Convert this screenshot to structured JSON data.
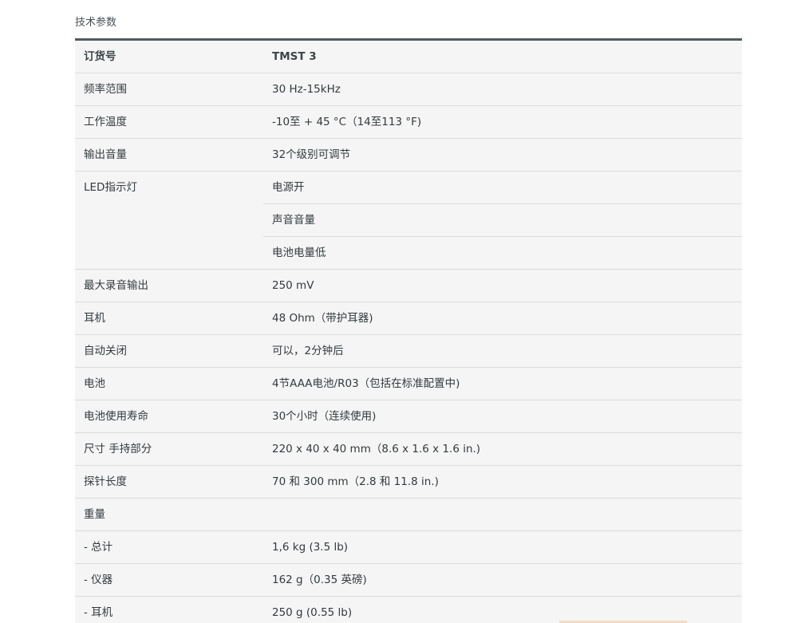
{
  "section_title": "技术参数",
  "table": {
    "header": {
      "label": "订货号",
      "value": "TMST 3"
    },
    "rows": [
      {
        "label": "频率范围",
        "value": "30 Hz-15kHz"
      },
      {
        "label": "工作温度",
        "value": "-10至 + 45 °C（14至113 °F)"
      },
      {
        "label": "输出音量",
        "value": "32个级别可调节"
      }
    ],
    "led": {
      "label": "LED指示灯",
      "values": [
        "电源开",
        "声音音量",
        "电池电量低"
      ]
    },
    "rows2": [
      {
        "label": "最大录音输出",
        "value": "250 mV"
      },
      {
        "label": "耳机",
        "value": "48 Ohm（带护耳器)"
      },
      {
        "label": "自动关闭",
        "value": "可以，2分钟后"
      },
      {
        "label": "电池",
        "value": "4节AAA电池/R03（包括在标准配置中)"
      },
      {
        "label": "电池使用寿命",
        "value": "30个小时（连续使用)"
      },
      {
        "label": "尺寸 手持部分",
        "value": "220 x 40 x 40 mm（8.6 x 1.6 x 1.6 in.)"
      },
      {
        "label": "探针长度",
        "value": "70 和 300 mm（2.8 和 11.8 in.)"
      },
      {
        "label": "重量",
        "value": ""
      },
      {
        "label": "- 总计",
        "value": "1,6 kg (3.5 lb)"
      },
      {
        "label": "- 仪器",
        "value": "162 g（0.35 英磅)"
      },
      {
        "label": "- 耳机",
        "value": "250 g (0.55 lb)"
      }
    ]
  }
}
